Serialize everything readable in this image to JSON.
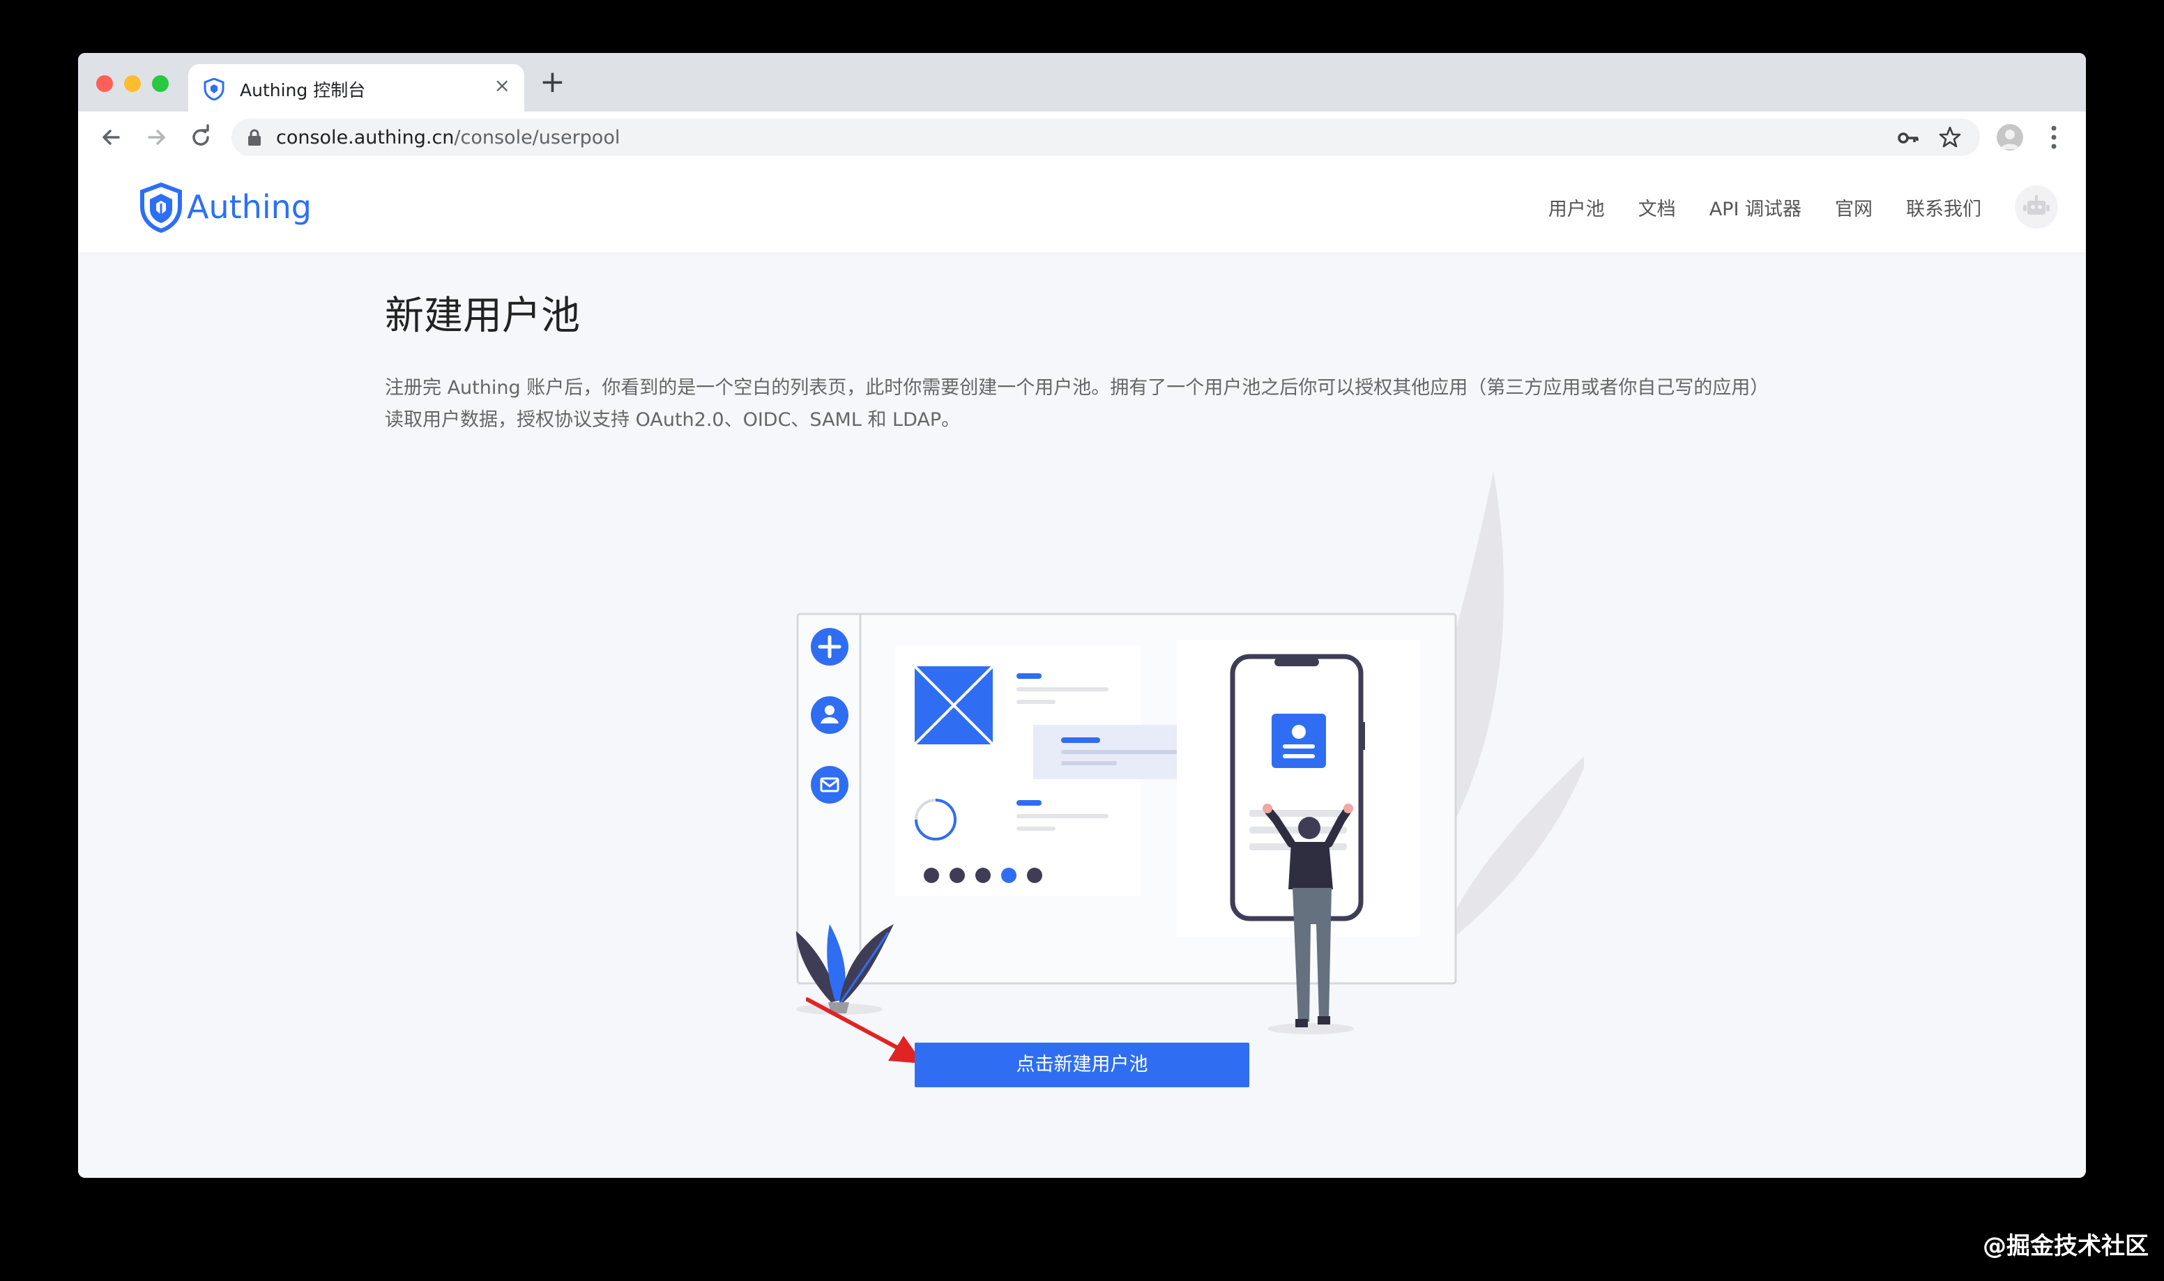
{
  "browser": {
    "tab_title": "Authing 控制台",
    "tab_close": "×",
    "new_tab": "+",
    "url_host": "console.authing.cn",
    "url_path": "/console/userpool"
  },
  "app": {
    "logo_text": "Authing",
    "nav": [
      "用户池",
      "文档",
      "API 调试器",
      "官网",
      "联系我们"
    ]
  },
  "page": {
    "title": "新建用户池",
    "description": "注册完 Authing 账户后，你看到的是一个空白的列表页，此时你需要创建一个用户池。拥有了一个用户池之后你可以授权其他应用（第三方应用或者你自己写的应用）读取用户数据，授权协议支持 OAuth2.0、OIDC、SAML 和 LDAP。",
    "cta_label": "点击新建用户池"
  },
  "watermark": "@掘金技术社区",
  "colors": {
    "accent": "#2f6ef2",
    "annotation_arrow": "#e02424"
  }
}
